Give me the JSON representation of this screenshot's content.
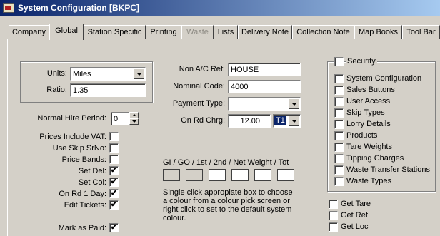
{
  "window": {
    "title": "System Configuration [BKPC]"
  },
  "tabs": [
    {
      "label": "Company",
      "state": "normal"
    },
    {
      "label": "Global",
      "state": "active"
    },
    {
      "label": "Station Specific",
      "state": "normal"
    },
    {
      "label": "Printing",
      "state": "normal"
    },
    {
      "label": "Waste",
      "state": "disabled"
    },
    {
      "label": "Lists",
      "state": "normal"
    },
    {
      "label": "Delivery Note",
      "state": "normal"
    },
    {
      "label": "Collection Note",
      "state": "normal"
    },
    {
      "label": "Map Books",
      "state": "normal"
    },
    {
      "label": "Tool Bar",
      "state": "normal"
    }
  ],
  "units": {
    "label": "Units:",
    "value": "Miles"
  },
  "ratio": {
    "label": "Ratio:",
    "value": "1.35"
  },
  "normal_hire": {
    "label": "Normal Hire Period:",
    "value": "0"
  },
  "left_checks": [
    {
      "label": "Prices Include VAT:",
      "checked": false
    },
    {
      "label": "Use Skip SrNo:",
      "checked": false
    },
    {
      "label": "Price Bands:",
      "checked": false
    },
    {
      "label": "Set Del:",
      "checked": true
    },
    {
      "label": "Set Col:",
      "checked": true
    },
    {
      "label": "On Rd 1 Day:",
      "checked": true
    },
    {
      "label": "Edit Tickets:",
      "checked": true
    }
  ],
  "mark_as_paid": {
    "label": "Mark as Paid:",
    "checked": true
  },
  "non_ac_ref": {
    "label": "Non A/C Ref:",
    "value": "HOUSE"
  },
  "nominal_code": {
    "label": "Nominal Code:",
    "value": "4000"
  },
  "payment_type": {
    "label": "Payment Type:",
    "value": ""
  },
  "on_rd_chrg": {
    "label": "On Rd Chrg:",
    "value": "12.00",
    "tax_code": "T1"
  },
  "weights": {
    "label": "GI / GO / 1st / 2nd / Net Weight / Tot",
    "swatch_colors": [
      "#d4d0c8",
      "#d4d0c8",
      "#ffffff",
      "#ffffff",
      "#ffffff",
      "#ffffff"
    ],
    "help_lines": [
      "Single click appropiate box to choose",
      "a colour from a colour pick screen or",
      "right click to set to the default system",
      "colour."
    ]
  },
  "security": {
    "label": "Security",
    "checked": false,
    "items": [
      {
        "label": "System Configuration",
        "checked": false
      },
      {
        "label": "Sales Buttons",
        "checked": false
      },
      {
        "label": "User Access",
        "checked": false
      },
      {
        "label": "Skip Types",
        "checked": false
      },
      {
        "label": "Lorry Details",
        "checked": false
      },
      {
        "label": "Products",
        "checked": false
      },
      {
        "label": "Tare Weights",
        "checked": false
      },
      {
        "label": "Tipping Charges",
        "checked": false
      },
      {
        "label": "Waste Transfer Stations",
        "checked": false
      },
      {
        "label": "Waste Types",
        "checked": false
      }
    ]
  },
  "get_checks": [
    {
      "label": "Get Tare",
      "checked": false
    },
    {
      "label": "Get Ref",
      "checked": false
    },
    {
      "label": "Get Loc",
      "checked": false
    }
  ],
  "check_mark": "✔"
}
